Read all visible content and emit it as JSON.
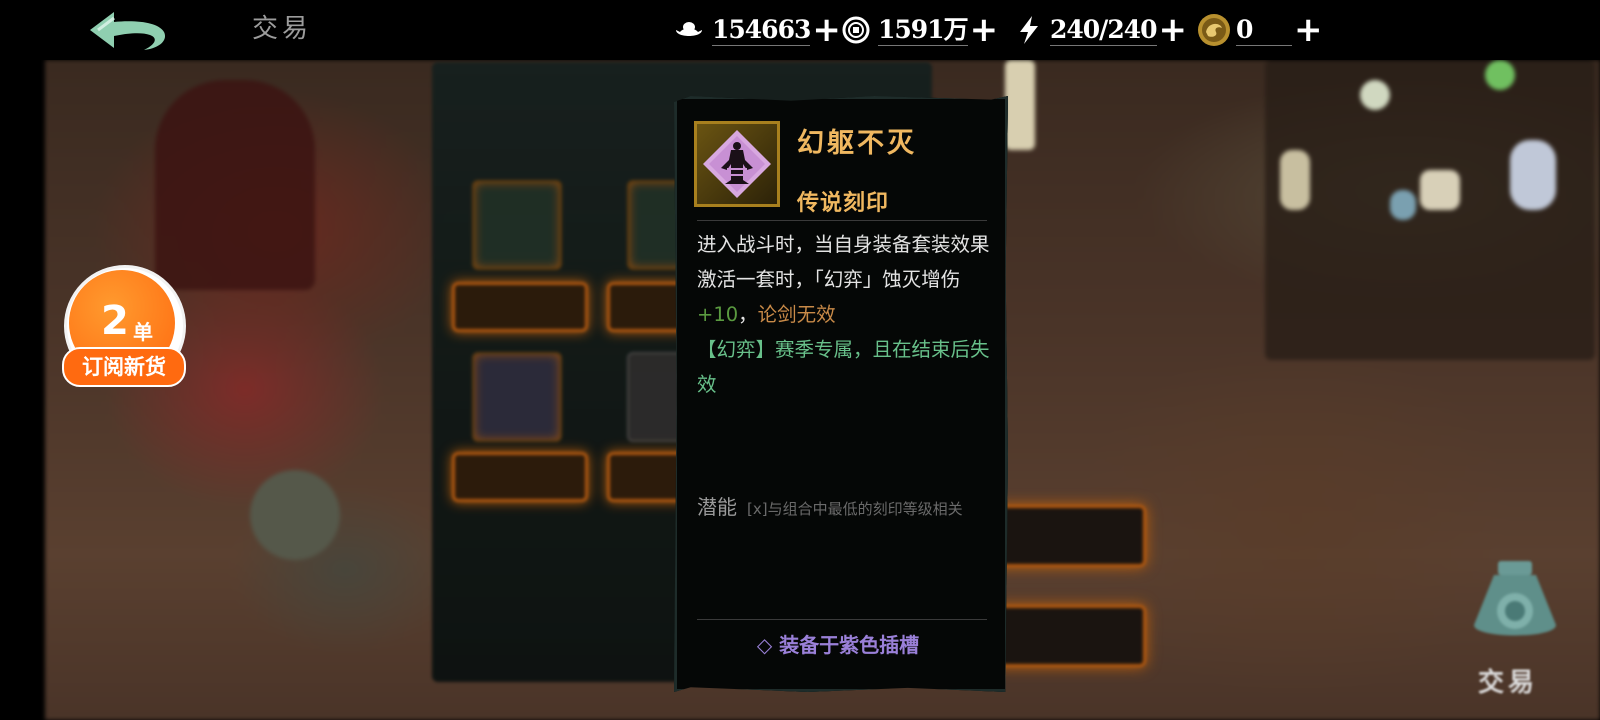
{
  "header": {
    "back_icon": "back-arrow-icon",
    "title": "交易"
  },
  "resources": [
    {
      "icon": "silver-ingot-icon",
      "value": "154663",
      "plus": "+"
    },
    {
      "icon": "copper-coin-icon",
      "value": "1591万",
      "plus": "+"
    },
    {
      "icon": "lightning-icon",
      "value": "240/240",
      "plus": "+"
    },
    {
      "icon": "gold-dragon-coin-icon",
      "value": "0",
      "plus": "+"
    }
  ],
  "subscribe": {
    "count": "2",
    "unit": "单",
    "label": "订阅新货"
  },
  "tooltip": {
    "icon": "imprint-figure-icon",
    "name": "幻躯不灭",
    "rarity": "传说刻印",
    "desc_part1": "进入战斗时，当自身装备套装效果激活一套时，「幻弈」蚀灭增伤",
    "desc_num": "+10",
    "desc_comma": "，",
    "desc_orange": "论剑无效",
    "desc_green": "【幻弈】赛季专属，且在结束后失效",
    "potential_label": "潜能",
    "potential_note": "[x]与组合中最低的刻印等级相关",
    "slot_note": "◇ 装备于紫色插槽",
    "colors": {
      "name": "#f0b860",
      "highlight_num": "#5a9a40",
      "highlight_orange": "#c88a48",
      "highlight_green": "#68c08a",
      "slot": "#9a80d8"
    }
  },
  "trade": {
    "icon": "trade-bag-icon",
    "label": "交易"
  }
}
